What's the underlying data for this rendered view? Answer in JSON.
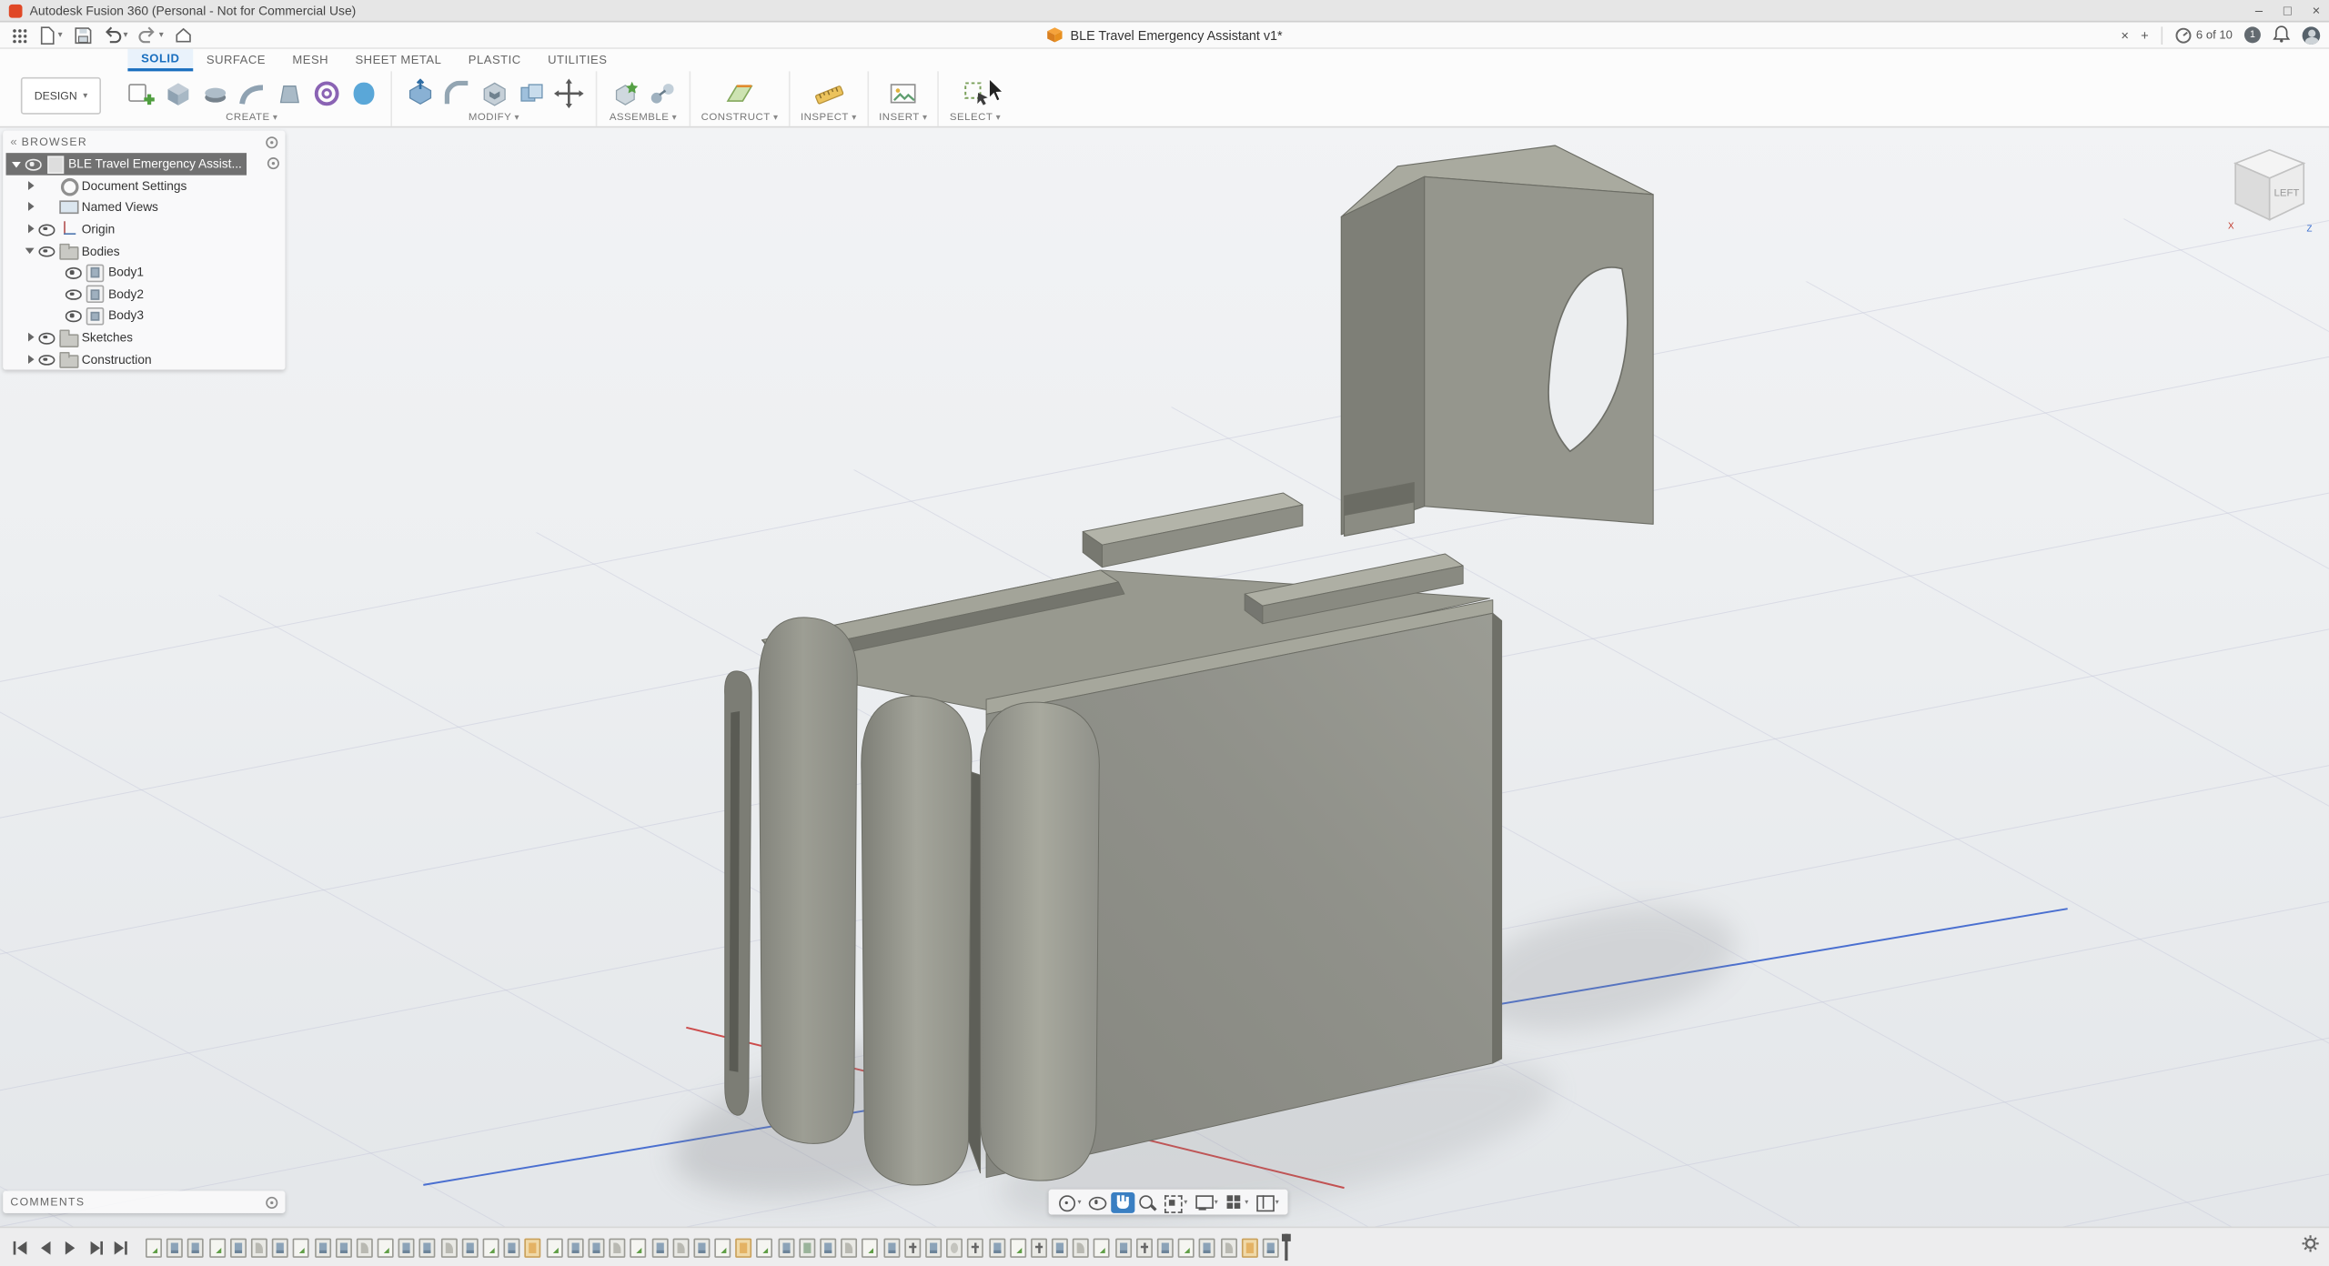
{
  "titlebar": {
    "title": "Autodesk Fusion 360 (Personal - Not for Commercial Use)",
    "minimize": "–",
    "maximize": "□",
    "close": "×"
  },
  "appbar": {
    "document_tab_title": "BLE Travel Emergency Assistant v1*",
    "close_tab": "×",
    "new_tab": "+",
    "job_status": "6 of 10",
    "updates_badge": "1"
  },
  "ribbon": {
    "design_menu_label": "DESIGN",
    "tabs": [
      {
        "label": "SOLID",
        "cls": "active"
      },
      {
        "label": "SURFACE",
        "cls": ""
      },
      {
        "label": "MESH",
        "cls": ""
      },
      {
        "label": "SHEET METAL",
        "cls": ""
      },
      {
        "label": "PLASTIC",
        "cls": ""
      },
      {
        "label": "UTILITIES",
        "cls": ""
      }
    ],
    "group_labels": {
      "create": "CREATE",
      "modify": "MODIFY",
      "assemble": "ASSEMBLE",
      "construct": "CONSTRUCT",
      "inspect": "INSPECT",
      "insert": "INSERT",
      "select": "SELECT"
    }
  },
  "browser": {
    "panel_title": "BROWSER",
    "items": [
      {
        "label": "BLE Travel Emergency Assist...",
        "cls": "lvl0 selected has-eye exp-down",
        "icon": "doc"
      },
      {
        "label": "Document Settings",
        "cls": "lvl1 exp-right",
        "icon": "gear"
      },
      {
        "label": "Named Views",
        "cls": "lvl1 exp-right",
        "icon": "views"
      },
      {
        "label": "Origin",
        "cls": "lvl1 exp-right has-eye",
        "icon": "origin"
      },
      {
        "label": "Bodies",
        "cls": "lvl1 exp-down has-eye",
        "icon": "folder"
      },
      {
        "label": "Body1",
        "cls": "lvl2 has-eye",
        "icon": "body"
      },
      {
        "label": "Body2",
        "cls": "lvl2 has-eye",
        "icon": "body"
      },
      {
        "label": "Body3",
        "cls": "lvl2 has-eye",
        "icon": "body"
      },
      {
        "label": "Sketches",
        "cls": "lvl1 exp-right has-eye",
        "icon": "folder"
      },
      {
        "label": "Construction",
        "cls": "lvl1 exp-right has-eye",
        "icon": "folder"
      }
    ]
  },
  "viewcube": {
    "face_label": "LEFT",
    "axis_x": "X",
    "axis_z": "Z"
  },
  "comments_panel": {
    "title": "COMMENTS"
  },
  "navbar": {
    "buttons": [
      {
        "name": "orbit",
        "cls": "has-caret"
      },
      {
        "name": "look-at",
        "cls": ""
      },
      {
        "name": "pan",
        "cls": "active"
      },
      {
        "name": "zoom",
        "cls": ""
      },
      {
        "name": "fit",
        "cls": "has-caret"
      },
      {
        "name": "display-settings",
        "cls": "has-caret"
      },
      {
        "name": "grid-snaps",
        "cls": "has-caret"
      },
      {
        "name": "viewports",
        "cls": "has-caret"
      }
    ]
  },
  "timeline": {
    "icons": [
      {
        "t": "sketch"
      },
      {
        "t": "extrude"
      },
      {
        "t": "extrude"
      },
      {
        "t": "sketch"
      },
      {
        "t": "extrude"
      },
      {
        "t": "fillet"
      },
      {
        "t": "extrude"
      },
      {
        "t": "sketch"
      },
      {
        "t": "extrude"
      },
      {
        "t": "extrude"
      },
      {
        "t": "fillet"
      },
      {
        "t": "sketch"
      },
      {
        "t": "extrude"
      },
      {
        "t": "extrude"
      },
      {
        "t": "fillet"
      },
      {
        "t": "extrude"
      },
      {
        "t": "sketch"
      },
      {
        "t": "extrude"
      },
      {
        "t": "plane"
      },
      {
        "t": "sketch"
      },
      {
        "t": "extrude"
      },
      {
        "t": "extrude"
      },
      {
        "t": "fillet"
      },
      {
        "t": "sketch"
      },
      {
        "t": "extrude"
      },
      {
        "t": "fillet"
      },
      {
        "t": "extrude"
      },
      {
        "t": "sketch"
      },
      {
        "t": "plane"
      },
      {
        "t": "sketch"
      },
      {
        "t": "extrude"
      },
      {
        "t": "combine"
      },
      {
        "t": "extrude"
      },
      {
        "t": "fillet"
      },
      {
        "t": "sketch"
      },
      {
        "t": "extrude"
      },
      {
        "t": "move"
      },
      {
        "t": "extrude"
      },
      {
        "t": "hole"
      },
      {
        "t": "move"
      },
      {
        "t": "extrude"
      },
      {
        "t": "sketch"
      },
      {
        "t": "move"
      },
      {
        "t": "extrude"
      },
      {
        "t": "fillet"
      },
      {
        "t": "sketch"
      },
      {
        "t": "extrude"
      },
      {
        "t": "move"
      },
      {
        "t": "extrude"
      },
      {
        "t": "sketch"
      },
      {
        "t": "extrude"
      },
      {
        "t": "fillet"
      },
      {
        "t": "plane"
      },
      {
        "t": "extrude"
      }
    ]
  }
}
